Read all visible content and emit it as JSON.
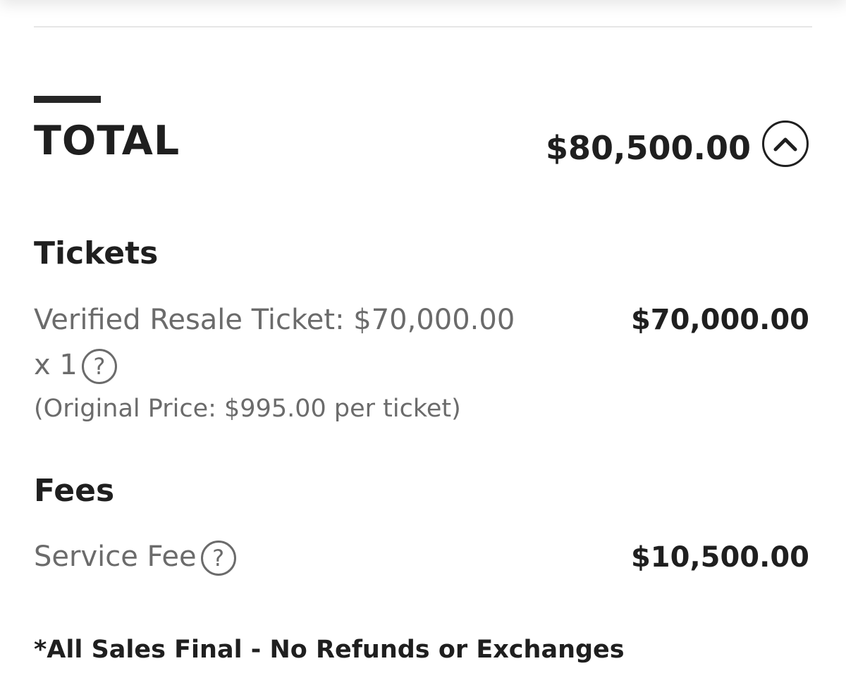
{
  "total": {
    "label": "TOTAL",
    "amount": "$80,500.00",
    "toggle_icon": "chevron-up-icon"
  },
  "tickets": {
    "title": "Tickets",
    "line_desc": "Verified Resale Ticket: $70,000.00",
    "quantity": "x 1",
    "help_glyph": "?",
    "amount": "$70,000.00",
    "original_price_note": "(Original Price: $995.00 per ticket)"
  },
  "fees": {
    "title": "Fees",
    "service_fee_label": "Service Fee",
    "help_glyph": "?",
    "amount": "$10,500.00"
  },
  "disclaimer": "*All Sales Final - No Refunds or Exchanges"
}
